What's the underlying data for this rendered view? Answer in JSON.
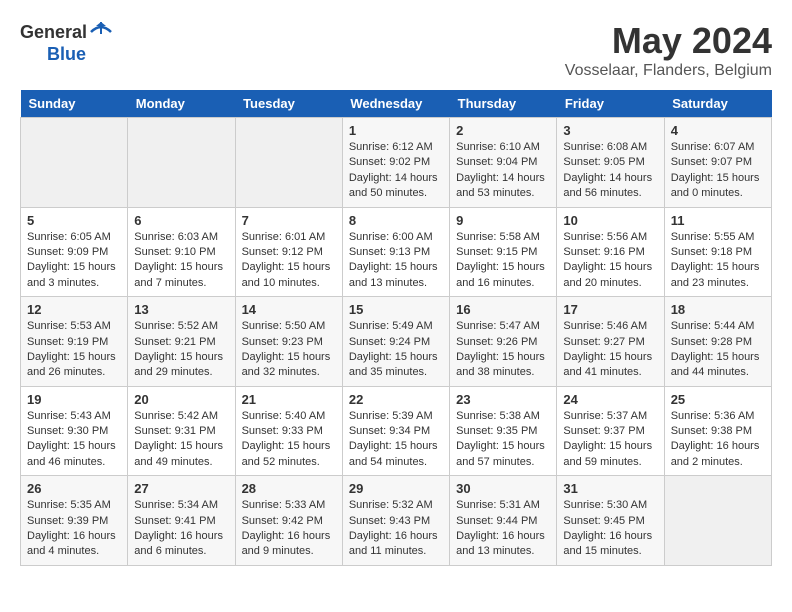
{
  "header": {
    "logo_general": "General",
    "logo_blue": "Blue",
    "month": "May 2024",
    "location": "Vosselaar, Flanders, Belgium"
  },
  "weekdays": [
    "Sunday",
    "Monday",
    "Tuesday",
    "Wednesday",
    "Thursday",
    "Friday",
    "Saturday"
  ],
  "weeks": [
    [
      {
        "day": "",
        "info": ""
      },
      {
        "day": "",
        "info": ""
      },
      {
        "day": "",
        "info": ""
      },
      {
        "day": "1",
        "info": "Sunrise: 6:12 AM\nSunset: 9:02 PM\nDaylight: 14 hours\nand 50 minutes."
      },
      {
        "day": "2",
        "info": "Sunrise: 6:10 AM\nSunset: 9:04 PM\nDaylight: 14 hours\nand 53 minutes."
      },
      {
        "day": "3",
        "info": "Sunrise: 6:08 AM\nSunset: 9:05 PM\nDaylight: 14 hours\nand 56 minutes."
      },
      {
        "day": "4",
        "info": "Sunrise: 6:07 AM\nSunset: 9:07 PM\nDaylight: 15 hours\nand 0 minutes."
      }
    ],
    [
      {
        "day": "5",
        "info": "Sunrise: 6:05 AM\nSunset: 9:09 PM\nDaylight: 15 hours\nand 3 minutes."
      },
      {
        "day": "6",
        "info": "Sunrise: 6:03 AM\nSunset: 9:10 PM\nDaylight: 15 hours\nand 7 minutes."
      },
      {
        "day": "7",
        "info": "Sunrise: 6:01 AM\nSunset: 9:12 PM\nDaylight: 15 hours\nand 10 minutes."
      },
      {
        "day": "8",
        "info": "Sunrise: 6:00 AM\nSunset: 9:13 PM\nDaylight: 15 hours\nand 13 minutes."
      },
      {
        "day": "9",
        "info": "Sunrise: 5:58 AM\nSunset: 9:15 PM\nDaylight: 15 hours\nand 16 minutes."
      },
      {
        "day": "10",
        "info": "Sunrise: 5:56 AM\nSunset: 9:16 PM\nDaylight: 15 hours\nand 20 minutes."
      },
      {
        "day": "11",
        "info": "Sunrise: 5:55 AM\nSunset: 9:18 PM\nDaylight: 15 hours\nand 23 minutes."
      }
    ],
    [
      {
        "day": "12",
        "info": "Sunrise: 5:53 AM\nSunset: 9:19 PM\nDaylight: 15 hours\nand 26 minutes."
      },
      {
        "day": "13",
        "info": "Sunrise: 5:52 AM\nSunset: 9:21 PM\nDaylight: 15 hours\nand 29 minutes."
      },
      {
        "day": "14",
        "info": "Sunrise: 5:50 AM\nSunset: 9:23 PM\nDaylight: 15 hours\nand 32 minutes."
      },
      {
        "day": "15",
        "info": "Sunrise: 5:49 AM\nSunset: 9:24 PM\nDaylight: 15 hours\nand 35 minutes."
      },
      {
        "day": "16",
        "info": "Sunrise: 5:47 AM\nSunset: 9:26 PM\nDaylight: 15 hours\nand 38 minutes."
      },
      {
        "day": "17",
        "info": "Sunrise: 5:46 AM\nSunset: 9:27 PM\nDaylight: 15 hours\nand 41 minutes."
      },
      {
        "day": "18",
        "info": "Sunrise: 5:44 AM\nSunset: 9:28 PM\nDaylight: 15 hours\nand 44 minutes."
      }
    ],
    [
      {
        "day": "19",
        "info": "Sunrise: 5:43 AM\nSunset: 9:30 PM\nDaylight: 15 hours\nand 46 minutes."
      },
      {
        "day": "20",
        "info": "Sunrise: 5:42 AM\nSunset: 9:31 PM\nDaylight: 15 hours\nand 49 minutes."
      },
      {
        "day": "21",
        "info": "Sunrise: 5:40 AM\nSunset: 9:33 PM\nDaylight: 15 hours\nand 52 minutes."
      },
      {
        "day": "22",
        "info": "Sunrise: 5:39 AM\nSunset: 9:34 PM\nDaylight: 15 hours\nand 54 minutes."
      },
      {
        "day": "23",
        "info": "Sunrise: 5:38 AM\nSunset: 9:35 PM\nDaylight: 15 hours\nand 57 minutes."
      },
      {
        "day": "24",
        "info": "Sunrise: 5:37 AM\nSunset: 9:37 PM\nDaylight: 15 hours\nand 59 minutes."
      },
      {
        "day": "25",
        "info": "Sunrise: 5:36 AM\nSunset: 9:38 PM\nDaylight: 16 hours\nand 2 minutes."
      }
    ],
    [
      {
        "day": "26",
        "info": "Sunrise: 5:35 AM\nSunset: 9:39 PM\nDaylight: 16 hours\nand 4 minutes."
      },
      {
        "day": "27",
        "info": "Sunrise: 5:34 AM\nSunset: 9:41 PM\nDaylight: 16 hours\nand 6 minutes."
      },
      {
        "day": "28",
        "info": "Sunrise: 5:33 AM\nSunset: 9:42 PM\nDaylight: 16 hours\nand 9 minutes."
      },
      {
        "day": "29",
        "info": "Sunrise: 5:32 AM\nSunset: 9:43 PM\nDaylight: 16 hours\nand 11 minutes."
      },
      {
        "day": "30",
        "info": "Sunrise: 5:31 AM\nSunset: 9:44 PM\nDaylight: 16 hours\nand 13 minutes."
      },
      {
        "day": "31",
        "info": "Sunrise: 5:30 AM\nSunset: 9:45 PM\nDaylight: 16 hours\nand 15 minutes."
      },
      {
        "day": "",
        "info": ""
      }
    ]
  ]
}
